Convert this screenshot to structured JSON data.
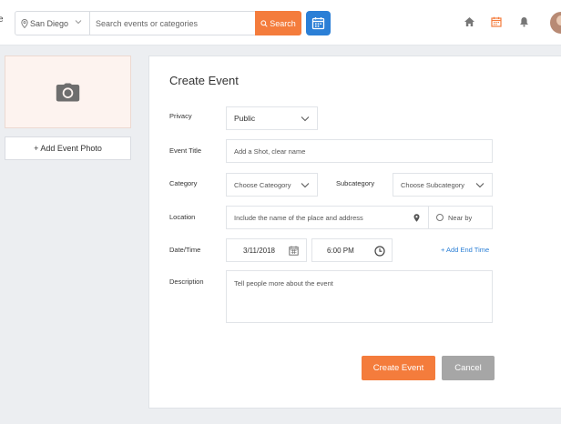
{
  "topbar": {
    "edge_char": "e",
    "location": "San Diego",
    "search_placeholder": "Search events or categories",
    "search_button": "Search",
    "icons": [
      "map-pin-icon",
      "chevron-down-icon",
      "search-icon",
      "calendar-icon",
      "home-icon",
      "calendar-icon",
      "bell-icon",
      "avatar"
    ],
    "accent_color": "#f47c3c",
    "calendar_button_color": "#2b7fd6"
  },
  "sidebar": {
    "photo_icon": "camera-icon",
    "add_photo_label": "+ Add Event Photo"
  },
  "form": {
    "title": "Create Event",
    "privacy": {
      "label": "Privacy",
      "value": "Public"
    },
    "event_title": {
      "label": "Event Title",
      "placeholder": "Add a Shot, clear name"
    },
    "category": {
      "label": "Category",
      "value": "Choose Cateogory"
    },
    "subcategory": {
      "label": "Subcategory",
      "value": "Choose Subcategory"
    },
    "location": {
      "label": "Location",
      "placeholder": "Include the name of the place and address",
      "near_by": "Near by"
    },
    "datetime": {
      "label": "Date/Time",
      "date": "3/11/2018",
      "time": "6:00 PM",
      "add_end_time": "+ Add End Time"
    },
    "description": {
      "label": "Description",
      "placeholder": "Tell people more about the event"
    },
    "create_button": "Create Event",
    "cancel_button": "Cancel"
  }
}
